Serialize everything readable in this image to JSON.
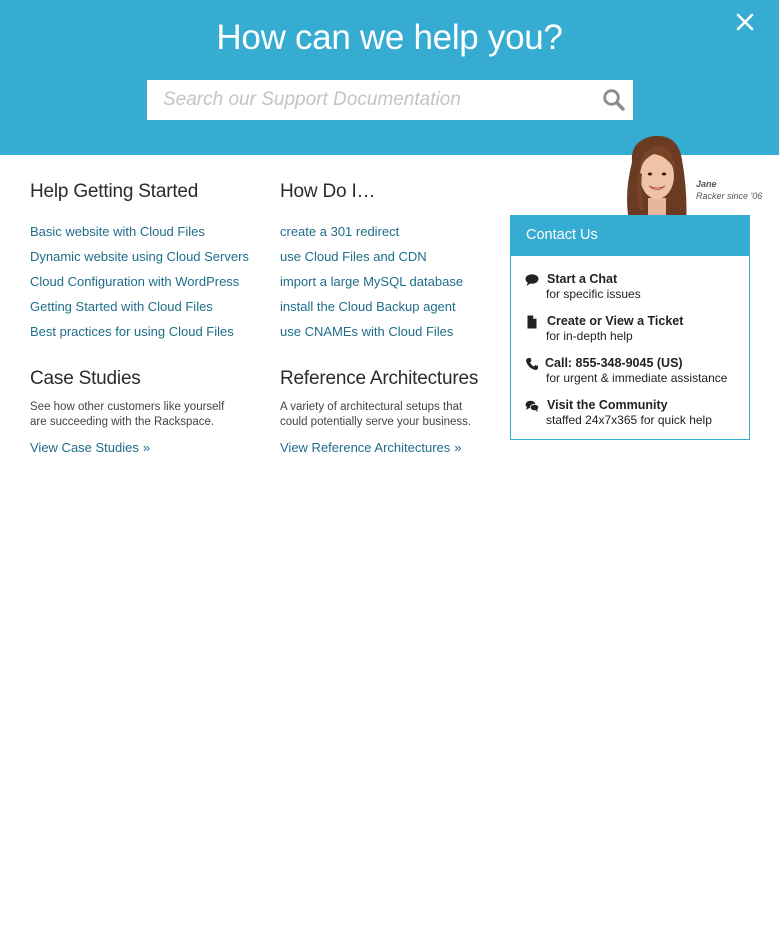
{
  "header": {
    "title": "How can we help you?",
    "close_icon": "close-icon",
    "search": {
      "placeholder": "Search our Support Documentation",
      "value": "",
      "icon": "search-icon"
    },
    "background_color": "#37acd3"
  },
  "help_getting_started": {
    "heading": "Help Getting Started",
    "links": [
      "Basic website with Cloud Files",
      "Dynamic website using Cloud Servers",
      "Cloud Configuration with WordPress",
      "Getting Started with Cloud Files",
      "Best practices for using Cloud Files"
    ]
  },
  "how_do_i": {
    "heading": "How Do I…",
    "links": [
      "create a 301 redirect",
      "use Cloud Files and CDN",
      "import a large MySQL database",
      "install the Cloud Backup agent",
      "use CNAMEs with Cloud Files"
    ]
  },
  "case_studies": {
    "heading": "Case Studies",
    "description": "See how other customers like yourself are succeeding with the Rackspace.",
    "link": "View Case Studies",
    "link_suffix": "»"
  },
  "reference_architectures": {
    "heading": "Reference Architectures",
    "description": "A variety of architectural setups that could potentially serve your business.",
    "link": "View Reference Architectures",
    "link_suffix": "»"
  },
  "racker": {
    "name": "Jane",
    "tagline": "Racker since '06"
  },
  "contact": {
    "title": "Contact Us",
    "items": [
      {
        "icon": "chat-icon",
        "title": "Start a Chat",
        "subtitle": "for specific issues"
      },
      {
        "icon": "document-icon",
        "title": "Create or View a Ticket",
        "subtitle": "for in-depth help"
      },
      {
        "icon": "phone-icon",
        "title": "Call: 855-348-9045 (US)",
        "subtitle": "for urgent & immediate assistance"
      },
      {
        "icon": "community-icon",
        "title": "Visit the Community",
        "subtitle": "staffed 24x7x365 for quick help"
      }
    ]
  },
  "colors": {
    "accent": "#37acd3",
    "link": "#1f6d8a",
    "heading": "#2b2b2b"
  }
}
